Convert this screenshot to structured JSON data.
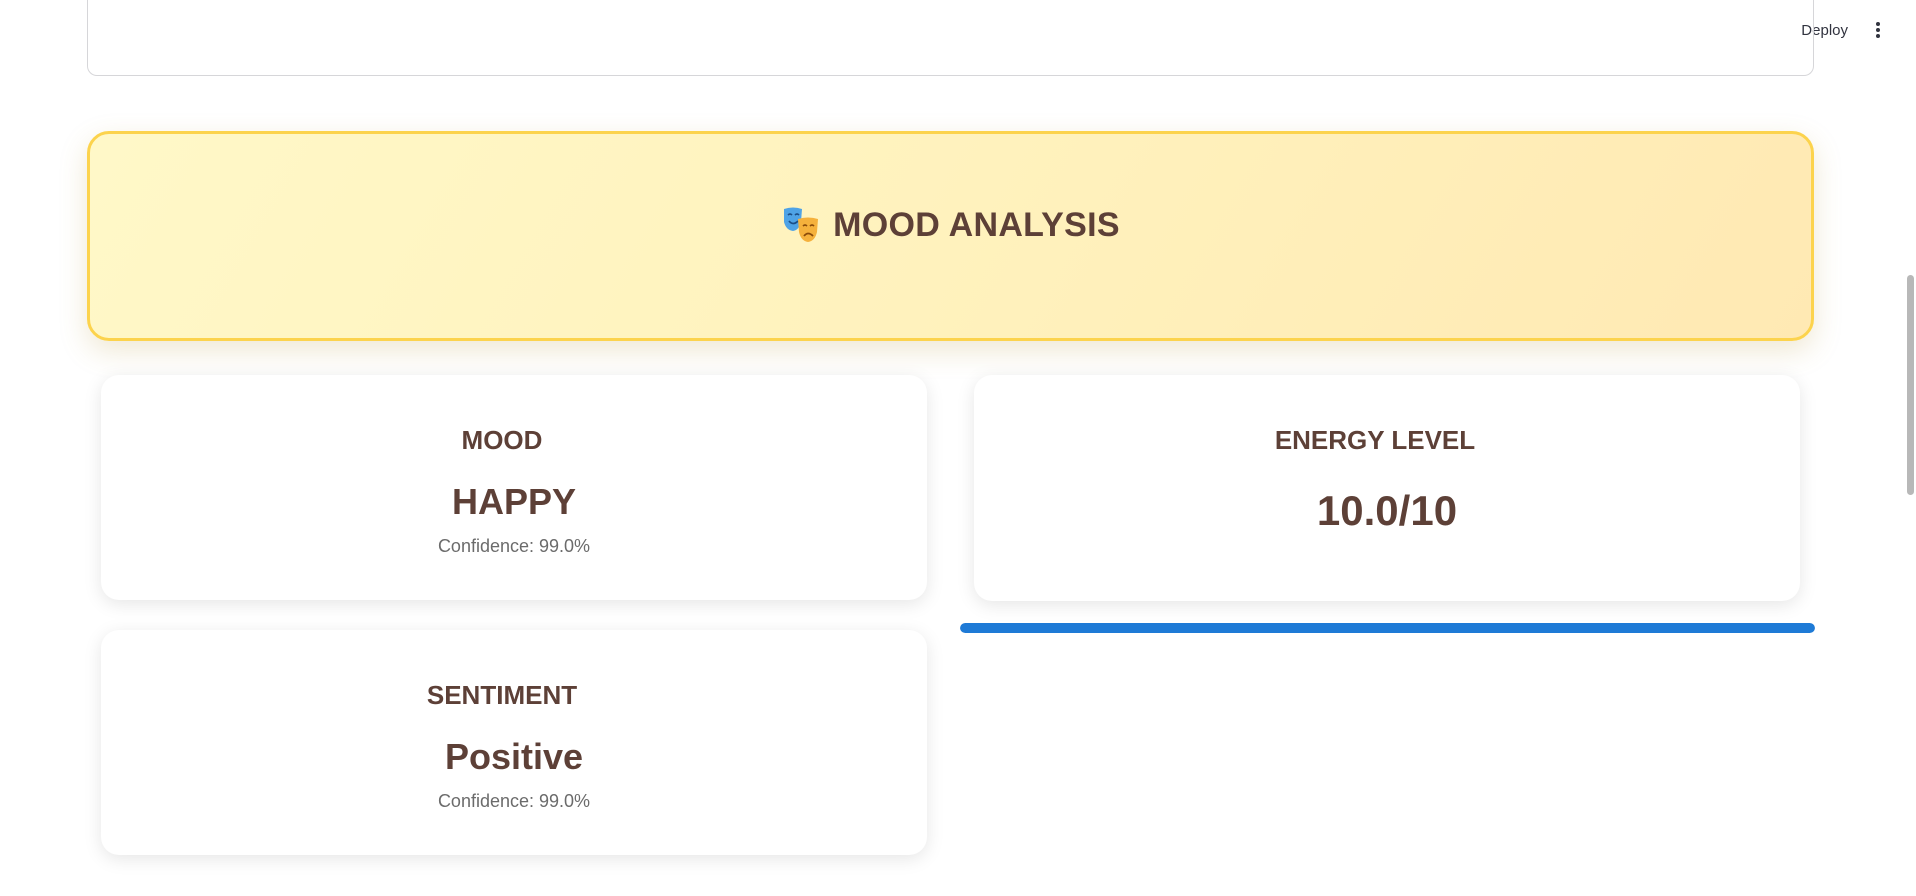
{
  "header": {
    "deploy_label": "Deploy",
    "menu_icon": "vertical-ellipsis-icon"
  },
  "banner": {
    "icon": "performing-arts-masks-icon",
    "title": "MOOD ANALYSIS"
  },
  "mood": {
    "label": "MOOD",
    "value": "HAPPY",
    "confidence": "Confidence: 99.0%"
  },
  "energy": {
    "label": "ENERGY LEVEL",
    "value": "10.0/10",
    "progress_fraction": 1.0
  },
  "sentiment": {
    "label": "SENTIMENT",
    "value": "Positive",
    "confidence": "Confidence: 99.0%"
  },
  "colors": {
    "text": "#5d4037",
    "banner_border": "#fcd34d",
    "progress": "#1e7ad6"
  }
}
